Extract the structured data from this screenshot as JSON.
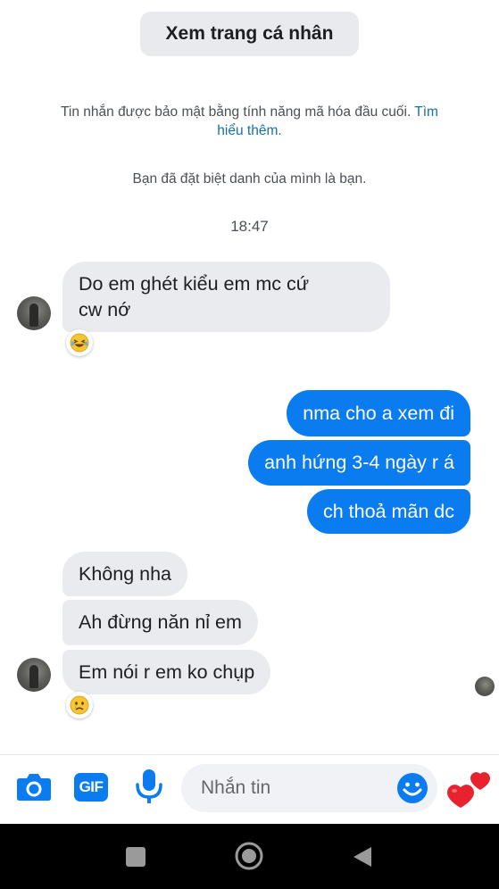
{
  "header": {
    "view_profile_label": "Xem trang cá nhân"
  },
  "system": {
    "encryption_text": "Tin nhắn được bảo mật bằng tính năng mã hóa đầu cuối.",
    "learn_more": "Tìm hiểu thêm.",
    "nickname_notice": "Bạn đã đặt biệt danh của mình là bạn.",
    "timestamp": "18:47"
  },
  "messages": [
    {
      "from": "them",
      "text_line1": "Do em ghét kiểu em mc cứ",
      "text_line2": "cw nớ",
      "reaction": "laughing-emoji"
    },
    {
      "from": "me",
      "text": "nma cho a xem đi"
    },
    {
      "from": "me",
      "text": "anh hứng 3-4 ngày r á"
    },
    {
      "from": "me",
      "text": "ch thoả mãn dc"
    },
    {
      "from": "them",
      "text": "Không nha"
    },
    {
      "from": "them",
      "text": "Ah đừng năn nỉ em"
    },
    {
      "from": "them",
      "text": "Em nói r em ko chụp",
      "reaction": "sad-emoji"
    }
  ],
  "composer": {
    "placeholder": "Nhắn tin",
    "gif_label": "GIF",
    "icons": [
      "camera-icon",
      "gif-icon",
      "microphone-icon",
      "emoji-icon",
      "heart-icon"
    ]
  },
  "navbar": {
    "icons": [
      "recent-apps-icon",
      "home-icon",
      "back-icon"
    ]
  },
  "colors": {
    "accent": "#0a7cf0",
    "incoming_bubble": "#e9ebee",
    "heart": "#e8222f"
  }
}
